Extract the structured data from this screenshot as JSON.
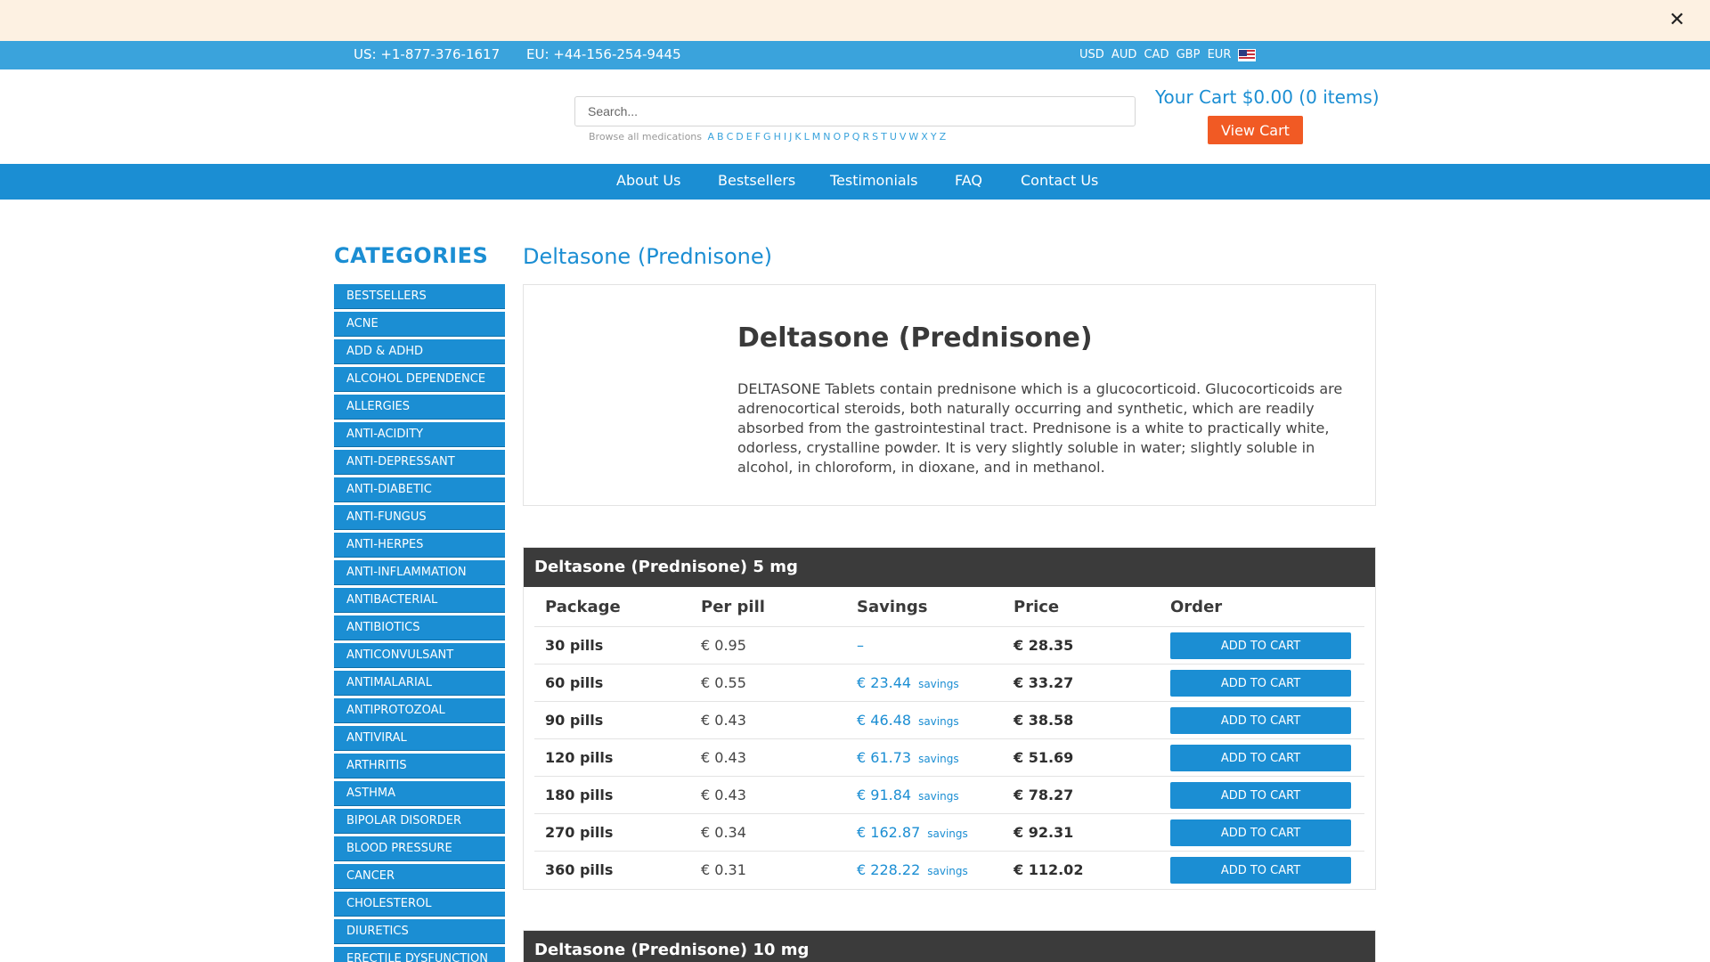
{
  "promo": {
    "close_icon": "close-icon",
    "close_glyph": "✕"
  },
  "topbar": {
    "phone_us": "US: +1-877-376-1617",
    "phone_eu": "EU: +44-156-254-9445",
    "currencies": [
      "USD",
      "AUD",
      "CAD",
      "GBP",
      "EUR"
    ],
    "flag_icon": "us-flag-icon"
  },
  "header": {
    "search_placeholder": "Search...",
    "browse_label": "Browse all medications",
    "letters": [
      "A",
      "B",
      "C",
      "D",
      "E",
      "F",
      "G",
      "H",
      "I",
      "J",
      "K",
      "L",
      "M",
      "N",
      "O",
      "P",
      "Q",
      "R",
      "S",
      "T",
      "U",
      "V",
      "W",
      "X",
      "Y",
      "Z"
    ],
    "cart_text": "Your Cart $0.00 (0 items)",
    "view_cart_label": "View Cart"
  },
  "nav": {
    "items": [
      "About Us",
      "Bestsellers",
      "Testimonials",
      "FAQ",
      "Contact Us"
    ]
  },
  "sidebar": {
    "title": "CATEGORIES",
    "items": [
      "Bestsellers",
      "Acne",
      "Add & Adhd",
      "Alcohol Dependence",
      "Allergies",
      "Anti-Acidity",
      "Anti-Depressant",
      "Anti-Diabetic",
      "Anti-Fungus",
      "Anti-Herpes",
      "Anti-Inflammation",
      "Antibacterial",
      "Antibiotics",
      "Anticonvulsant",
      "Antimalarial",
      "Antiprotozoal",
      "Antiviral",
      "Arthritis",
      "Asthma",
      "Bipolar Disorder",
      "Blood Pressure",
      "Cancer",
      "Cholesterol",
      "Diuretics",
      "Erectile Dysfunction"
    ]
  },
  "product": {
    "page_title": "Deltasone (Prednisone)",
    "heading": "Deltasone (Prednisone)",
    "description": "DELTASONE Tablets contain prednisone which is a glucocorticoid. Glucocorticoids are adrenocortical steroids, both naturally occurring and synthetic, which are readily absorbed from the gastrointestinal tract. Prednisone is a white to practically white, odorless, crystalline powder. It is very slightly soluble in water; slightly soluble in alcohol, in chloroform, in dioxane, and in methanol."
  },
  "table_headers": {
    "package": "Package",
    "per_pill": "Per pill",
    "savings": "Savings",
    "price": "Price",
    "order": "Order"
  },
  "add_to_cart_label": "Add to cart",
  "savings_word": "savings",
  "doses": [
    {
      "title": "Deltasone (Prednisone) 5 mg",
      "rows": [
        {
          "package": "30 pills",
          "per_pill": "€ 0.95",
          "savings": "–",
          "show_savings_word": false,
          "price": "€ 28.35"
        },
        {
          "package": "60 pills",
          "per_pill": "€ 0.55",
          "savings": "€ 23.44",
          "show_savings_word": true,
          "price": "€ 33.27"
        },
        {
          "package": "90 pills",
          "per_pill": "€ 0.43",
          "savings": "€ 46.48",
          "show_savings_word": true,
          "price": "€ 38.58"
        },
        {
          "package": "120 pills",
          "per_pill": "€ 0.43",
          "savings": "€ 61.73",
          "show_savings_word": true,
          "price": "€ 51.69"
        },
        {
          "package": "180 pills",
          "per_pill": "€ 0.43",
          "savings": "€ 91.84",
          "show_savings_word": true,
          "price": "€ 78.27"
        },
        {
          "package": "270 pills",
          "per_pill": "€ 0.34",
          "savings": "€ 162.87",
          "show_savings_word": true,
          "price": "€ 92.31"
        },
        {
          "package": "360 pills",
          "per_pill": "€ 0.31",
          "savings": "€ 228.22",
          "show_savings_word": true,
          "price": "€ 112.02"
        }
      ]
    },
    {
      "title": "Deltasone (Prednisone) 10 mg",
      "rows": []
    }
  ]
}
